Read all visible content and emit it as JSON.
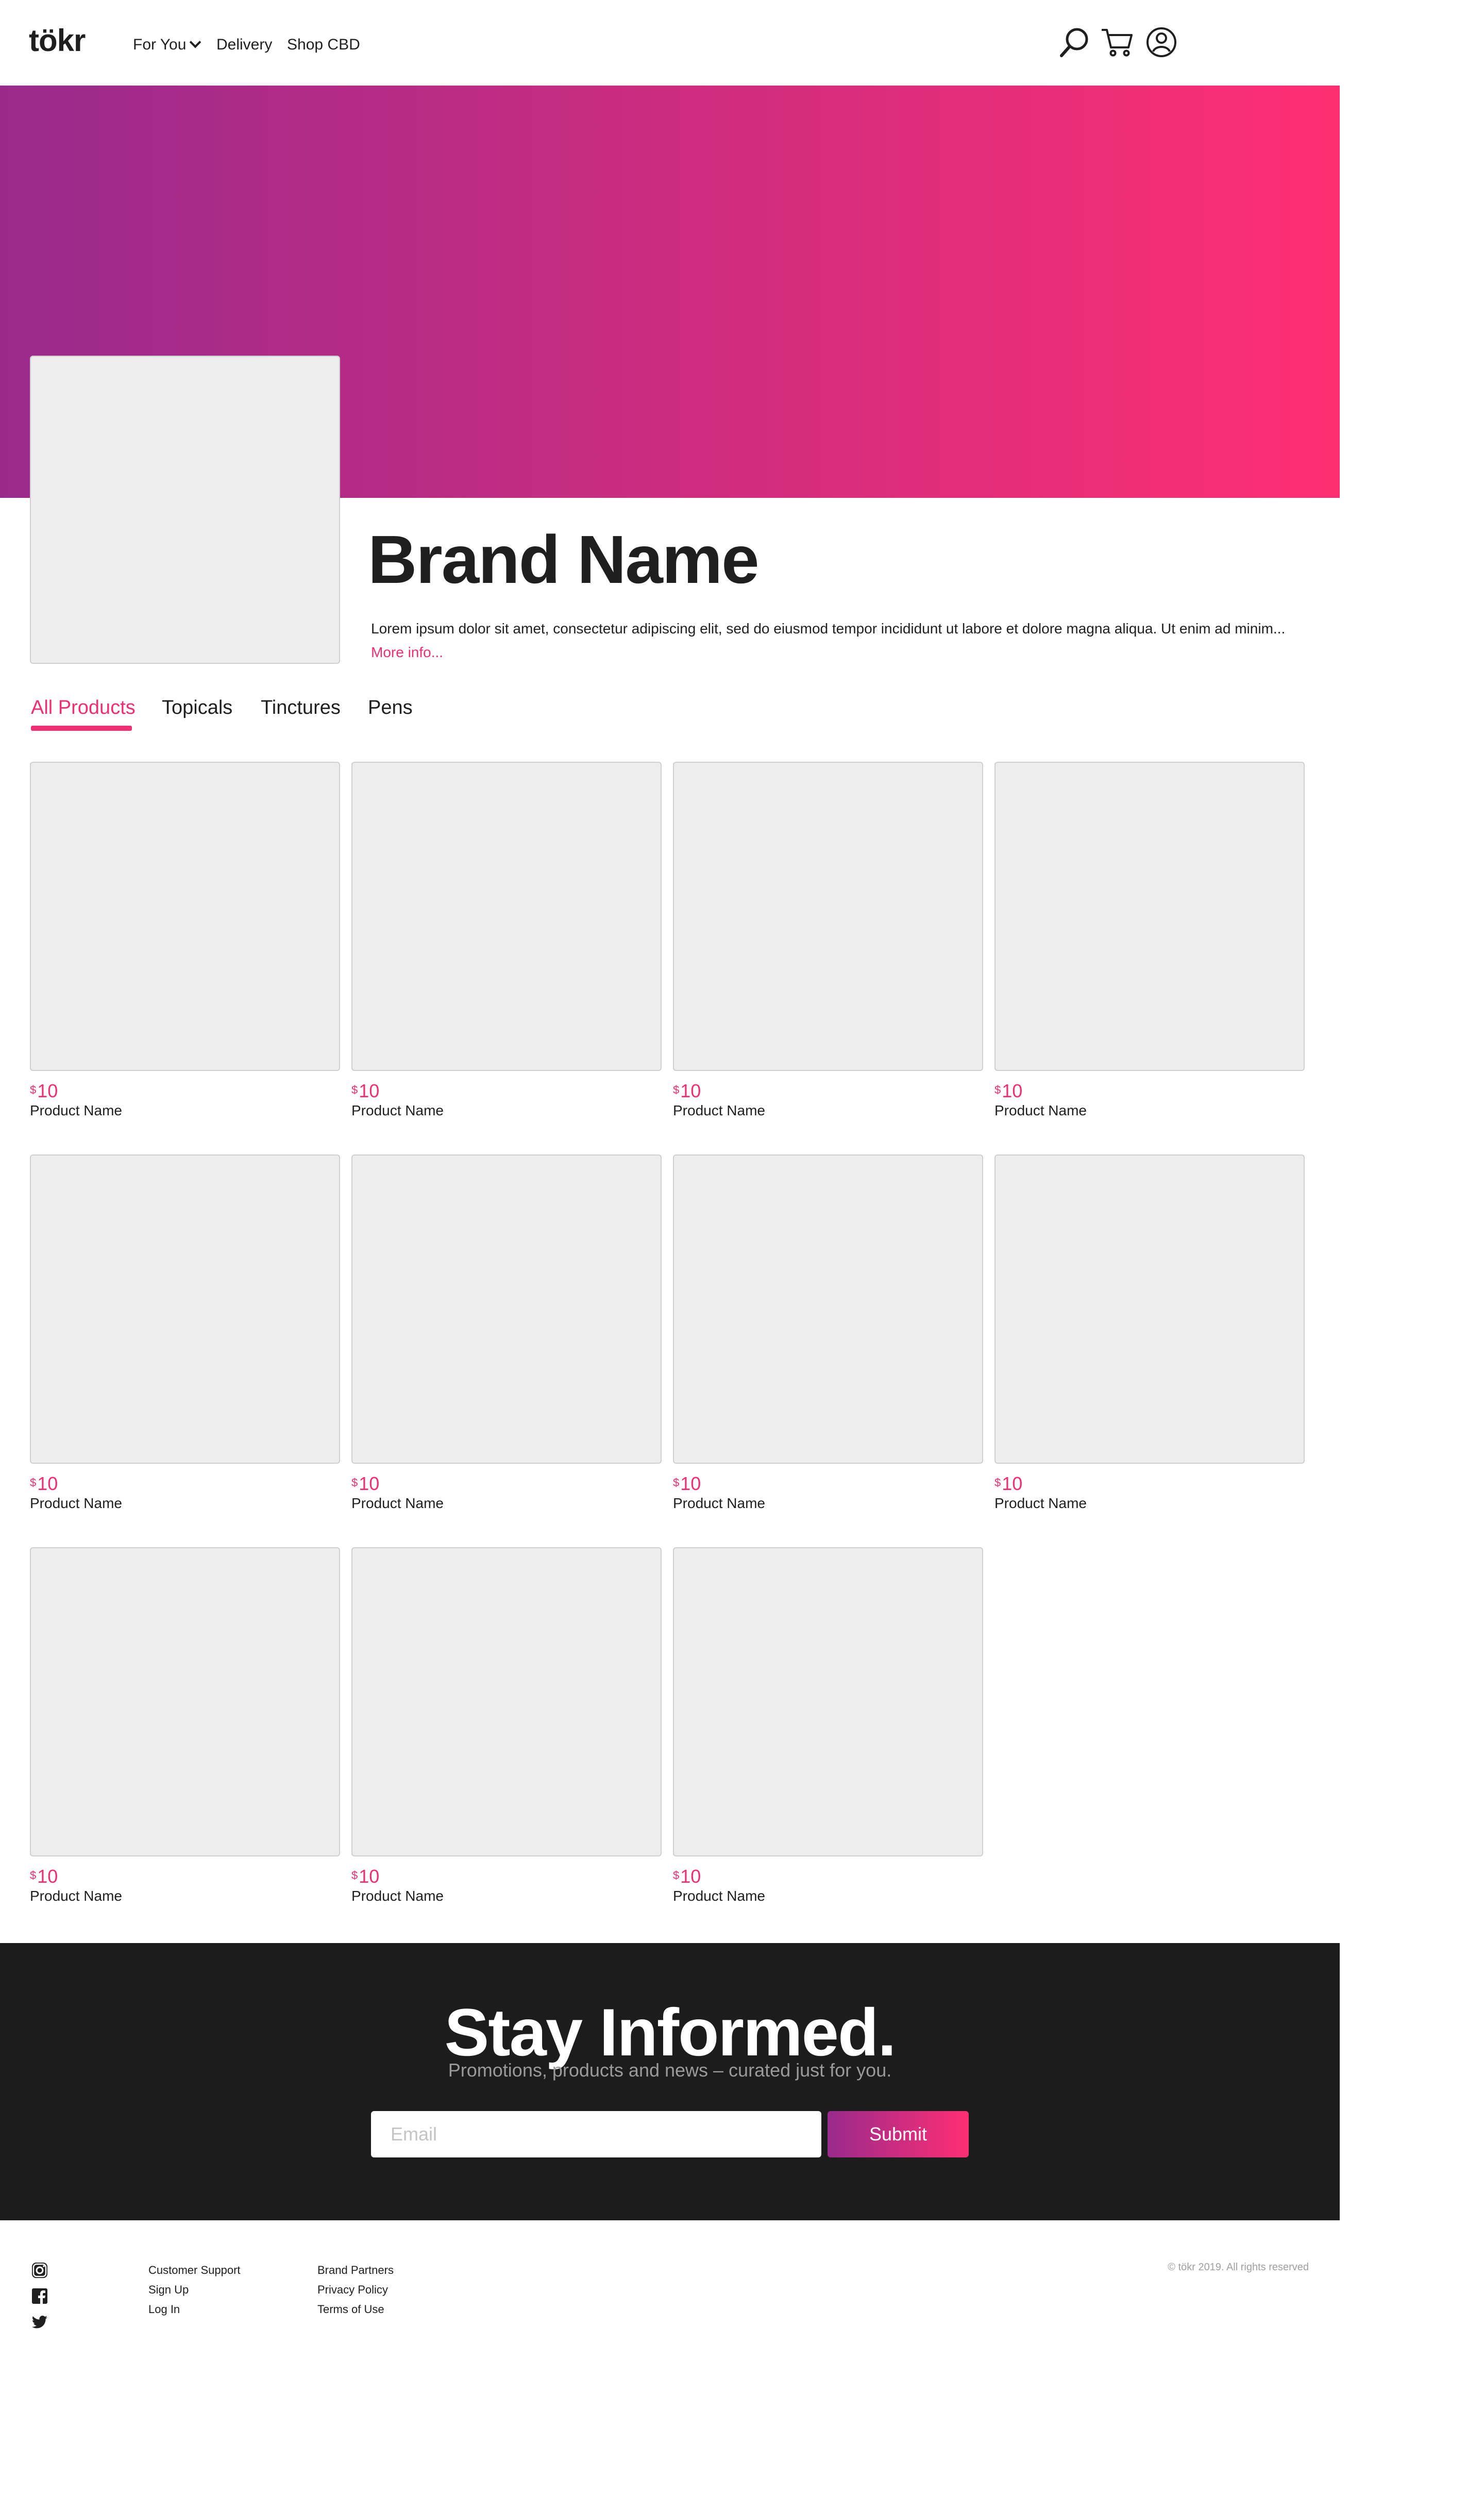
{
  "header": {
    "logo": "tökr",
    "nav": [
      {
        "label": "For You",
        "has_dropdown": true
      },
      {
        "label": "Delivery"
      },
      {
        "label": "Shop CBD"
      }
    ],
    "icons": [
      "search-icon",
      "cart-icon",
      "account-icon"
    ]
  },
  "hero": {
    "gradient_start": "#992a8c",
    "gradient_end": "#ff2e73"
  },
  "brand": {
    "name": "Brand Name",
    "description": "Lorem ipsum dolor sit amet, consectetur adipiscing elit, sed do eiusmod tempor incididunt ut labore et dolore magna aliqua. Ut enim ad minim...",
    "more_info": "More info..."
  },
  "tabs": [
    {
      "label": "All Products",
      "active": true
    },
    {
      "label": "Topicals"
    },
    {
      "label": "Tinctures"
    },
    {
      "label": "Pens"
    }
  ],
  "products": [
    {
      "currency": "$",
      "price": "10",
      "name": "Product Name"
    },
    {
      "currency": "$",
      "price": "10",
      "name": "Product Name"
    },
    {
      "currency": "$",
      "price": "10",
      "name": "Product Name"
    },
    {
      "currency": "$",
      "price": "10",
      "name": "Product Name"
    },
    {
      "currency": "$",
      "price": "10",
      "name": "Product Name"
    },
    {
      "currency": "$",
      "price": "10",
      "name": "Product Name"
    },
    {
      "currency": "$",
      "price": "10",
      "name": "Product Name"
    },
    {
      "currency": "$",
      "price": "10",
      "name": "Product Name"
    },
    {
      "currency": "$",
      "price": "10",
      "name": "Product Name"
    },
    {
      "currency": "$",
      "price": "10",
      "name": "Product Name"
    },
    {
      "currency": "$",
      "price": "10",
      "name": "Product Name"
    }
  ],
  "newsletter": {
    "title": "Stay Informed.",
    "subtitle": "Promotions, products and news – curated just for you.",
    "email_placeholder": "Email",
    "email_value": "",
    "submit_label": "Submit"
  },
  "footer": {
    "social": [
      "instagram-icon",
      "facebook-icon",
      "twitter-icon"
    ],
    "col1": [
      "Customer Support",
      "Sign Up",
      "Log In"
    ],
    "col2": [
      "Brand Partners",
      "Privacy Policy",
      "Terms of Use"
    ],
    "copyright": "© tökr 2019. All rights reserved"
  },
  "colors": {
    "accent": "#f02e73",
    "dark": "#1c1c1c",
    "placeholder_gray": "#ededed"
  }
}
